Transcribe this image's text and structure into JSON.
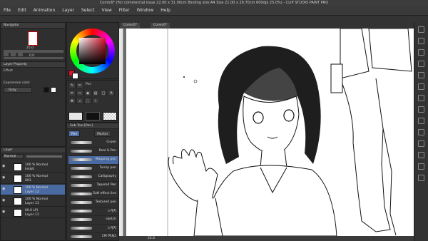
{
  "window": {
    "title": "Comic6* (For commercial issue 22.00 x 31.00cm Binding size:A4 Size 21.00 x 29.70cm 600dpi 25.0%) - CLIP STUDIO PAINT PRO"
  },
  "menu": [
    "File",
    "Edit",
    "Animation",
    "Layer",
    "Select",
    "View",
    "Filter",
    "Window",
    "Help"
  ],
  "navigator": {
    "title": "Navigator",
    "zoom": "25.0",
    "rotation": "0.0"
  },
  "layer_property": {
    "title": "Layer Property",
    "effect_label": "Effect",
    "expression_label": "Expression color",
    "expression_value": "Gray"
  },
  "tool": {
    "title": "Pen"
  },
  "subtool": {
    "title": "Sub Tool [Pen]",
    "tabs": [
      "Pen",
      "Marker"
    ],
    "brushes": [
      {
        "name": "G-pen",
        "selected": false
      },
      {
        "name": "Real G-Pen",
        "selected": false
      },
      {
        "name": "Mapping pen",
        "selected": true
      },
      {
        "name": "Turnip pen",
        "selected": false
      },
      {
        "name": "Calligraphy",
        "selected": false
      },
      {
        "name": "Tapered Pen",
        "selected": false
      },
      {
        "name": "Soft effect line",
        "selected": false
      },
      {
        "name": "Textured pen",
        "selected": false
      },
      {
        "name": "스케치",
        "selected": false
      },
      {
        "name": "sketch",
        "selected": false
      },
      {
        "name": "스케치",
        "selected": false
      },
      {
        "name": "CM PEN2",
        "selected": false
      }
    ]
  },
  "layers": {
    "title": "Layer",
    "blend": "Normal",
    "rows": [
      {
        "line1": "100 % Normal",
        "line2": "Ink&tl",
        "selected": false
      },
      {
        "line1": "100 % Normal",
        "line2": "003",
        "selected": false
      },
      {
        "line1": "100 % Normal",
        "line2": "Layer 12",
        "selected": true
      },
      {
        "line1": "100 % Normal",
        "line2": "Layer 13",
        "selected": false
      },
      {
        "line1": "60.0 LPI",
        "line2": "Layer 11",
        "selected": false
      }
    ]
  },
  "canvas": {
    "tabs": [
      "Comic6*",
      "Comic6*"
    ]
  },
  "status": {
    "zoom": "25.0"
  },
  "colors": {
    "main": "#d4142b",
    "accent": "#4a6aa2"
  }
}
